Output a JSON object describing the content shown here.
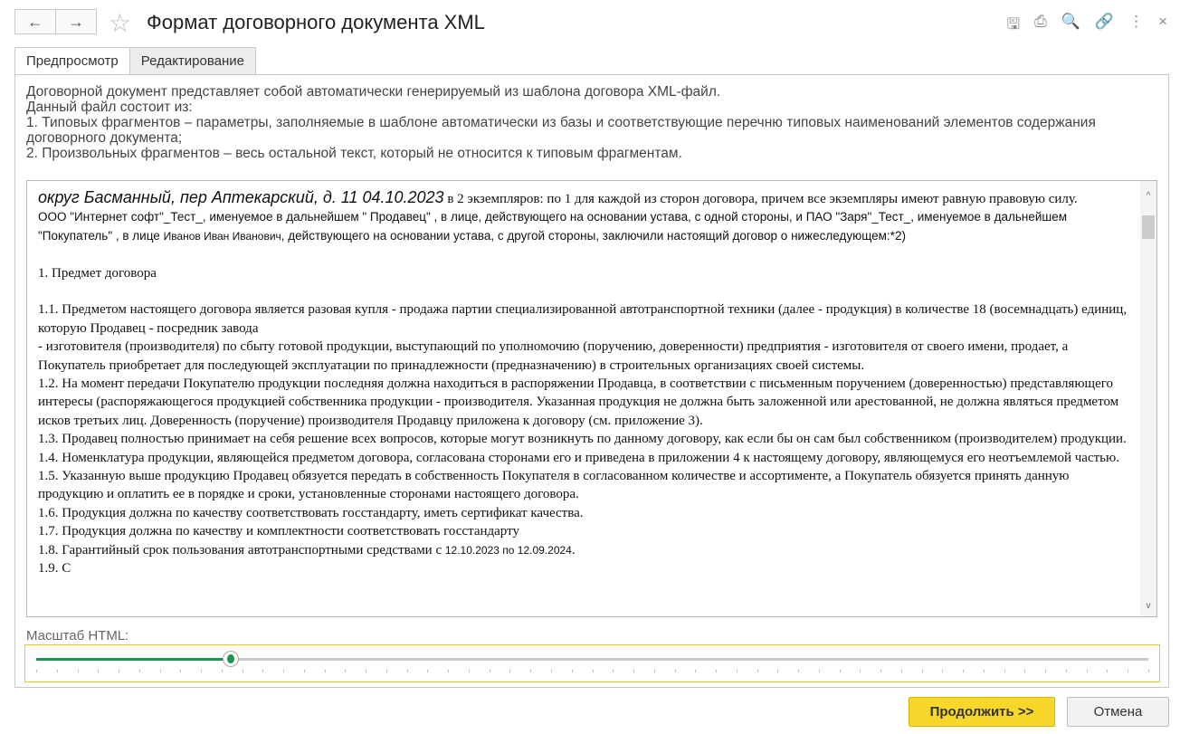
{
  "window": {
    "title": "Формат договорного документа XML",
    "back_icon": "←",
    "forward_icon": "→"
  },
  "toolbar_icons": [
    "save-icon",
    "print-icon",
    "preview-icon",
    "link-icon",
    "more-icon",
    "close-icon"
  ],
  "tabs": [
    {
      "label": "Предпросмотр",
      "active": true
    },
    {
      "label": "Редактирование",
      "active": false
    }
  ],
  "intro": [
    "Договорной документ представляет собой автоматически генерируемый из шаблона договора XML-файл.",
    "Данный файл состоит из:",
    "1. Типовых фрагментов – параметры, заполняемые в шаблоне автоматически из базы и соответствующие перечню типовых наименований элементов содержания договорного документа;",
    "2. Произвольных фрагментов – весь остальной текст, который не относится к типовым фрагментам."
  ],
  "document": {
    "header_big": "округ Басманный, пер Аптекарский, д. 11 04.10.2023",
    "header_rest": " в 2 экземпляров: по 1 для каждой из сторон договора, причем все экземпляры имеют равную правовую силу.",
    "parties_a": "ООО \"Интернет софт\"_Тест_, именуемое в дальнейшем \" Продавец\" , в лице, действующего на основании устава, с одной стороны, и ПАО \"Заря\"_Тест_, именуемое в дальнейшем \"Покупатель\" , в лице ",
    "parties_name": "Иванов Иван Иванович",
    "parties_b": ", действующего на основании устава, с другой стороны, заключили настоящий договор о нижеследующем:*2)",
    "section1": "1. Предмет договора",
    "paragraphs": [
      "1.1. Предметом настоящего договора является разовая купля - продажа партии специализированной автотранспортной техники (далее - продукция) в количестве 18 (восемнадцать) единиц, которую Продавец - посредник завода",
      "- изготовителя (производителя) по сбыту готовой продукции, выступающий по уполномочию (поручению, доверенности) предприятия - изготовителя от своего имени, продает, а Покупатель приобретает для последующей эксплуатации по принадлежности (предназначению) в строительных организациях своей системы.",
      "1.2. На момент передачи Покупателю продукции последняя должна находиться в распоряжении Продавца, в соответствии с письменным поручением (доверенностью) представляющего интересы (распоряжающегося продукцией собственника продукции - производителя. Указанная продукция не должна быть заложенной или арестованной, не должна являться предметом исков третьих лиц. Доверенность (поручение) производителя Продавцу приложена к договору (см. приложение 3).",
      "1.3. Продавец полностью принимает на себя решение всех вопросов, которые могут возникнуть по данному договору, как если бы он сам был собственником (производителем) продукции.",
      "1.4. Номенклатура продукции, являющейся предметом договора, согласована сторонами его и приведена в приложении 4 к настоящему договору, являющемуся его неотъемлемой частью.",
      "1.5. Указанную выше продукцию Продавец обязуется передать в собственность Покупателя в согласованном количестве и ассортименте, а Покупатель обязуется принять данную продукцию и оплатить ее в порядке и сроки, установленные сторонами настоящего договора.",
      "1.6. Продукция должна по качеству соответствовать госстандарту, иметь сертификат качества.",
      "1.7. Продукция должна по качеству и комплектности соответствовать госстандарту"
    ],
    "p18_a": "1.8. Гарантийный срок пользования автотранспортными средствами с ",
    "p18_from": "12.10.2023",
    "p18_mid": " по ",
    "p18_to": "12.09.2024",
    "p18_end": ".",
    "p19_partial": "1.9. С"
  },
  "scale": {
    "label": "Масштаб HTML:",
    "value_fraction": 0.175,
    "tick_count": 55
  },
  "buttons": {
    "continue": "Продолжить >>",
    "cancel": "Отмена"
  }
}
